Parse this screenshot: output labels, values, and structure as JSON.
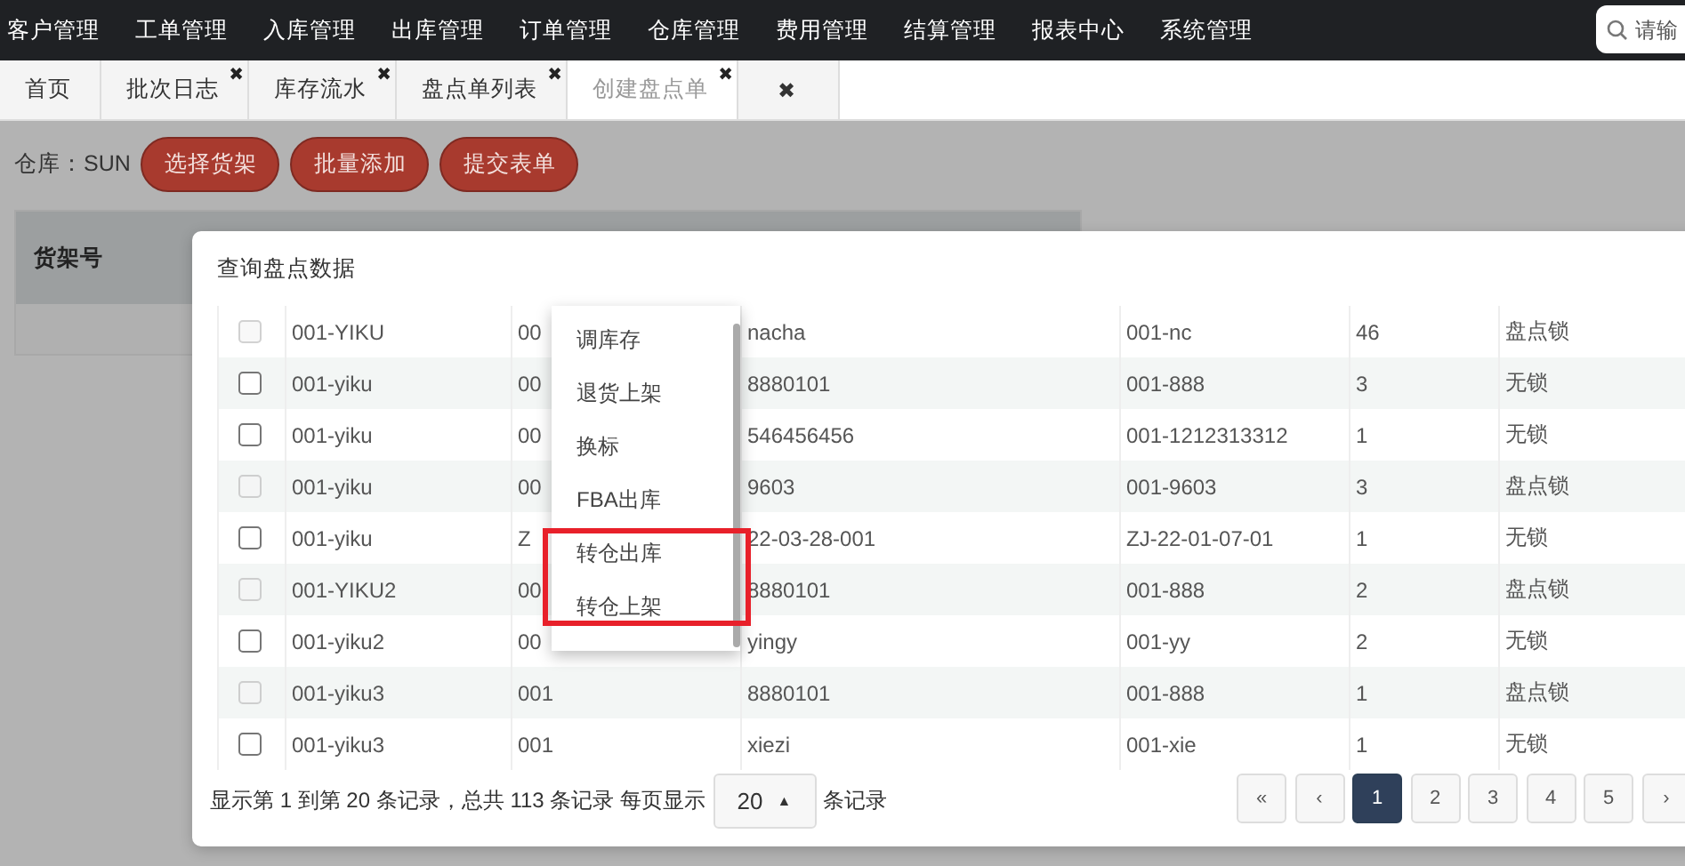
{
  "nav": {
    "items": [
      "客户管理",
      "工单管理",
      "入库管理",
      "出库管理",
      "订单管理",
      "仓库管理",
      "费用管理",
      "结算管理",
      "报表中心",
      "系统管理"
    ],
    "search": {
      "placeholder": "请输"
    }
  },
  "tabs": [
    {
      "label": "首页",
      "closable": false,
      "selected": false
    },
    {
      "label": "批次日志",
      "closable": true,
      "selected": false
    },
    {
      "label": "库存流水",
      "closable": true,
      "selected": false
    },
    {
      "label": "盘点单列表",
      "closable": true,
      "selected": false
    },
    {
      "label": "创建盘点单",
      "closable": true,
      "selected": true
    },
    {
      "kind": "close_all",
      "closable": true,
      "selected": false
    }
  ],
  "close_glyph": "✖",
  "toolbar": {
    "warehouse": "仓库：SUN",
    "buttons": [
      "选择货架",
      "批量添加",
      "提交表单"
    ]
  },
  "background_table": {
    "columns": [
      "货架号"
    ]
  },
  "modal": {
    "title": "查询盘点数据",
    "rows": [
      {
        "disabled": true,
        "cells": [
          "001-YIKU",
          "00",
          "nacha",
          "001-nc",
          "46",
          "盘点锁"
        ]
      },
      {
        "disabled": false,
        "cells": [
          "001-yiku",
          "00",
          "8880101",
          "001-888",
          "3",
          "无锁"
        ]
      },
      {
        "disabled": false,
        "cells": [
          "001-yiku",
          "00",
          "546456456",
          "001-1212313312",
          "1",
          "无锁"
        ]
      },
      {
        "disabled": true,
        "cells": [
          "001-yiku",
          "00",
          "9603",
          "001-9603",
          "3",
          "盘点锁"
        ]
      },
      {
        "disabled": false,
        "cells": [
          "001-yiku",
          "Z",
          "22-03-28-001",
          "ZJ-22-01-07-01",
          "1",
          "无锁"
        ]
      },
      {
        "disabled": true,
        "cells": [
          "001-YIKU2",
          "00",
          "8880101",
          "001-888",
          "2",
          "盘点锁"
        ]
      },
      {
        "disabled": false,
        "cells": [
          "001-yiku2",
          "00",
          "yingy",
          "001-yy",
          "2",
          "无锁"
        ]
      },
      {
        "disabled": true,
        "cells": [
          "001-yiku3",
          "001",
          "8880101",
          "001-888",
          "1",
          "盘点锁"
        ]
      },
      {
        "disabled": false,
        "cells": [
          "001-yiku3",
          "001",
          "xiezi",
          "001-xie",
          "1",
          "无锁"
        ]
      }
    ],
    "menu": {
      "items": [
        "调库存",
        "退货上架",
        "换标",
        "FBA出库",
        "转仓出库",
        "转仓上架"
      ]
    },
    "pagination": {
      "summary": "显示第 1 到第 20 条记录，总共 113 条记录 每页显示",
      "page_size": "20",
      "caret": "▲",
      "suffix": "条记录",
      "pages": [
        {
          "label": "«",
          "selected": false
        },
        {
          "label": "‹",
          "selected": false
        },
        {
          "label": "1",
          "selected": true
        },
        {
          "label": "2",
          "selected": false
        },
        {
          "label": "3",
          "selected": false
        },
        {
          "label": "4",
          "selected": false
        },
        {
          "label": "5",
          "selected": false
        },
        {
          "label": "›",
          "selected": false
        }
      ]
    }
  }
}
